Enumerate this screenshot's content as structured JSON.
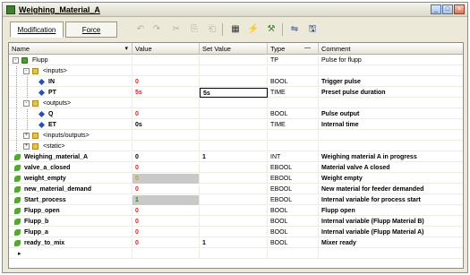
{
  "window": {
    "title": "Weighing_Material_A",
    "buttons": [
      "_",
      "□",
      "×"
    ]
  },
  "toolbar": {
    "tabs": [
      {
        "label": "Modification",
        "active": true
      },
      {
        "label": "Force",
        "active": false
      }
    ],
    "icons": [
      "undo-icon",
      "redo-icon",
      "cut-icon",
      "copy-icon",
      "paste-icon",
      "table-icon",
      "flash-icon",
      "tools-icon",
      "network-icon",
      "save-icon"
    ]
  },
  "grid": {
    "columns": [
      "Name",
      "Value",
      "Set Value",
      "Type",
      "Comment"
    ],
    "rows": [
      {
        "name": "Flupp",
        "value": "",
        "set": "",
        "type": "TP",
        "comment": "Pulse for flupp",
        "level": 0,
        "icon": "green",
        "expander": "-",
        "bold": false
      },
      {
        "name": "<inputs>",
        "value": "",
        "set": "",
        "type": "",
        "comment": "",
        "level": 1,
        "icon": "folder",
        "expander": "-",
        "bold": false
      },
      {
        "name": "IN",
        "value": "0",
        "set": "",
        "type": "BOOL",
        "comment": "Trigger pulse",
        "level": 2,
        "icon": "diamond",
        "expander": "",
        "bold": true,
        "valueStyle": "red"
      },
      {
        "name": "PT",
        "value": "5s",
        "set": "5s",
        "type": "TIME",
        "comment": "Preset pulse duration",
        "level": 2,
        "icon": "diamond",
        "expander": "",
        "bold": true,
        "valueStyle": "red",
        "editing": true
      },
      {
        "name": "<outputs>",
        "value": "",
        "set": "",
        "type": "",
        "comment": "",
        "level": 1,
        "icon": "folder",
        "expander": "-",
        "bold": false
      },
      {
        "name": "Q",
        "value": "0",
        "set": "",
        "type": "BOOL",
        "comment": "Pulse output",
        "level": 2,
        "icon": "diamond",
        "expander": "",
        "bold": true,
        "valueStyle": "red"
      },
      {
        "name": "ET",
        "value": "0s",
        "set": "",
        "type": "TIME",
        "comment": "Internal time",
        "level": 2,
        "icon": "diamond",
        "expander": "",
        "bold": true,
        "valueStyle": "black"
      },
      {
        "name": "<inputs/outputs>",
        "value": "",
        "set": "",
        "type": "",
        "comment": "",
        "level": 1,
        "icon": "folder",
        "expander": "+",
        "bold": false
      },
      {
        "name": "<static>",
        "value": "",
        "set": "",
        "type": "",
        "comment": "",
        "level": 1,
        "icon": "folder",
        "expander": "+",
        "bold": false
      },
      {
        "name": "Weighing_material_A",
        "value": "0",
        "set": "1",
        "type": "INT",
        "comment": "Weighing material A in progress",
        "level": 0,
        "icon": "leaf",
        "expander": "",
        "bold": true,
        "valueStyle": "black"
      },
      {
        "name": "valve_a_closed",
        "value": "0",
        "set": "",
        "type": "EBOOL",
        "comment": "Material valve A closed",
        "level": 0,
        "icon": "leaf",
        "expander": "",
        "bold": true,
        "valueStyle": "red"
      },
      {
        "name": "weight_empty",
        "value": "0",
        "set": "",
        "type": "EBOOL",
        "comment": "Weight empty",
        "level": 0,
        "icon": "leaf",
        "expander": "",
        "bold": true,
        "valueStyle": "gray"
      },
      {
        "name": "new_material_demand",
        "value": "0",
        "set": "",
        "type": "EBOOL",
        "comment": "New material for feeder demanded",
        "level": 0,
        "icon": "leaf",
        "expander": "",
        "bold": true,
        "valueStyle": "red"
      },
      {
        "name": "Start_process",
        "value": "1",
        "set": "",
        "type": "EBOOL",
        "comment": "Internal variable for process start",
        "level": 0,
        "icon": "leaf",
        "expander": "",
        "bold": true,
        "valueStyle": "graygreen"
      },
      {
        "name": "Flupp_open",
        "value": "0",
        "set": "",
        "type": "BOOL",
        "comment": "Flupp open",
        "level": 0,
        "icon": "leaf",
        "expander": "",
        "bold": true,
        "valueStyle": "red"
      },
      {
        "name": "Flupp_b",
        "value": "0",
        "set": "",
        "type": "BOOL",
        "comment": "Internal variable (Flupp Material B)",
        "level": 0,
        "icon": "leaf",
        "expander": "",
        "bold": true,
        "valueStyle": "red"
      },
      {
        "name": "Flupp_a",
        "value": "0",
        "set": "",
        "type": "BOOL",
        "comment": "Internal variable (Flupp Material A)",
        "level": 0,
        "icon": "leaf",
        "expander": "",
        "bold": true,
        "valueStyle": "red"
      },
      {
        "name": "ready_to_mix",
        "value": "0",
        "set": "1",
        "type": "BOOL",
        "comment": "Mixer ready",
        "level": 0,
        "icon": "leaf",
        "expander": "",
        "bold": true,
        "valueStyle": "red"
      },
      {
        "name": "",
        "value": "",
        "set": "",
        "type": "",
        "comment": "",
        "level": 0,
        "icon": "none",
        "expander": "",
        "bold": false,
        "marker": "▸"
      }
    ]
  }
}
